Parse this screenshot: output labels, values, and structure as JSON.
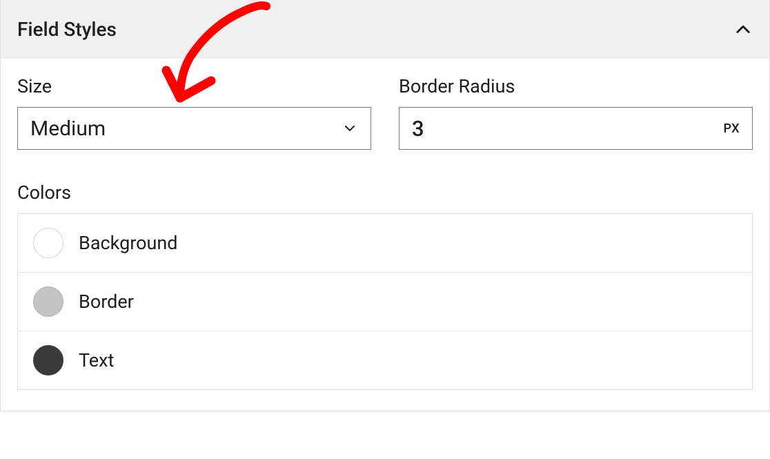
{
  "panel": {
    "title": "Field Styles"
  },
  "size": {
    "label": "Size",
    "value": "Medium"
  },
  "borderRadius": {
    "label": "Border Radius",
    "value": "3",
    "unit": "PX"
  },
  "colors": {
    "label": "Colors",
    "items": [
      {
        "name": "Background",
        "swatch": "#ffffff",
        "border": "#d0d0d0"
      },
      {
        "name": "Border",
        "swatch": "#c4c4c4",
        "border": "#b0b0b0"
      },
      {
        "name": "Text",
        "swatch": "#3a3a3a",
        "border": "#3a3a3a"
      }
    ]
  }
}
